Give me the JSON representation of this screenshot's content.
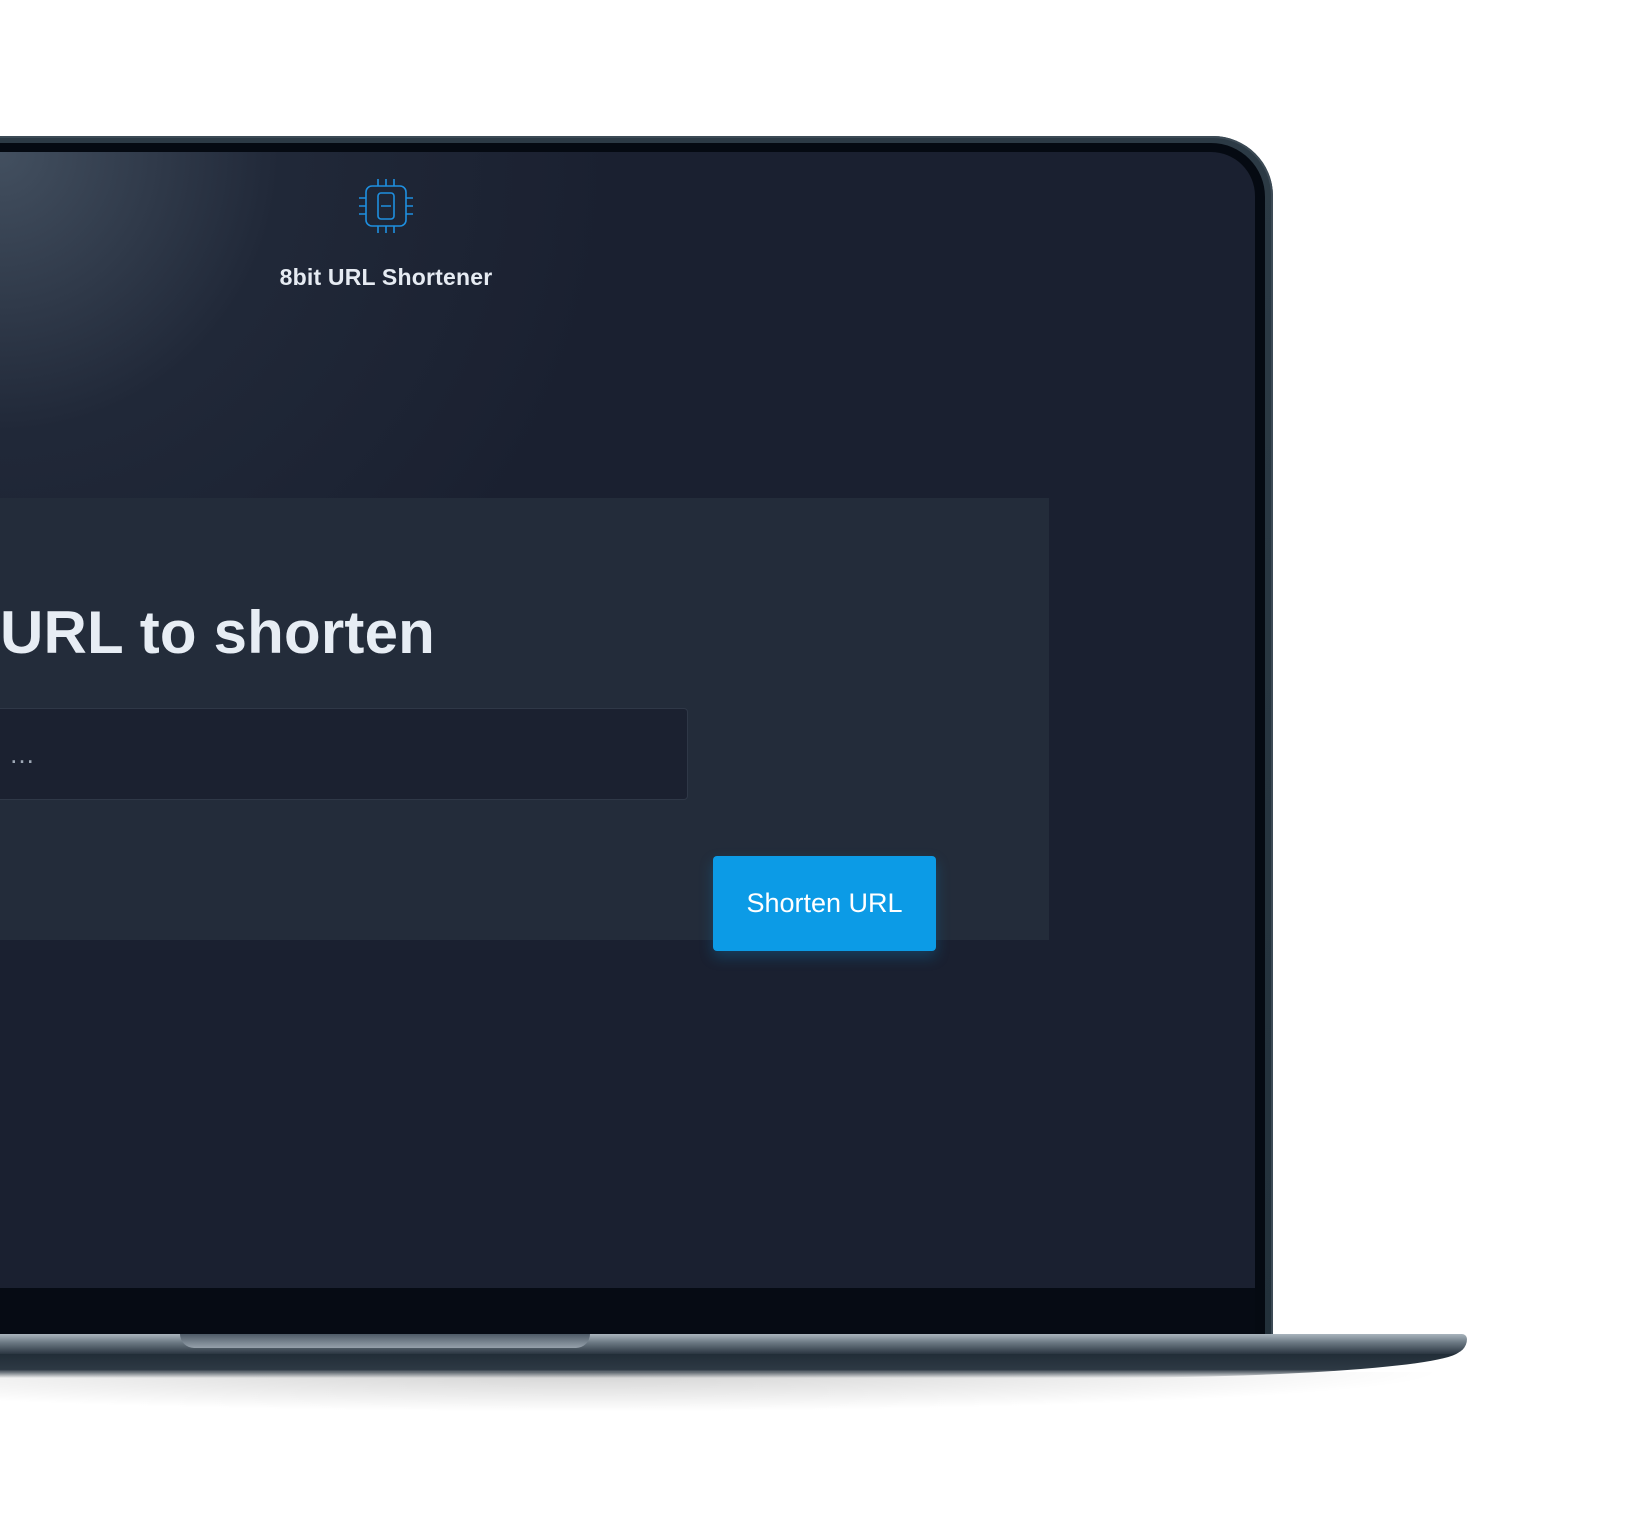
{
  "header": {
    "logo_icon": "chip-8-icon",
    "title": "8bit URL Shortener"
  },
  "main": {
    "heading": "URL to shorten",
    "input": {
      "value": "",
      "placeholder": "…"
    },
    "submit_label": "Shorten URL"
  },
  "colors": {
    "accent": "#0c9be6",
    "background": "#1a2030",
    "card": "#232c3a"
  }
}
